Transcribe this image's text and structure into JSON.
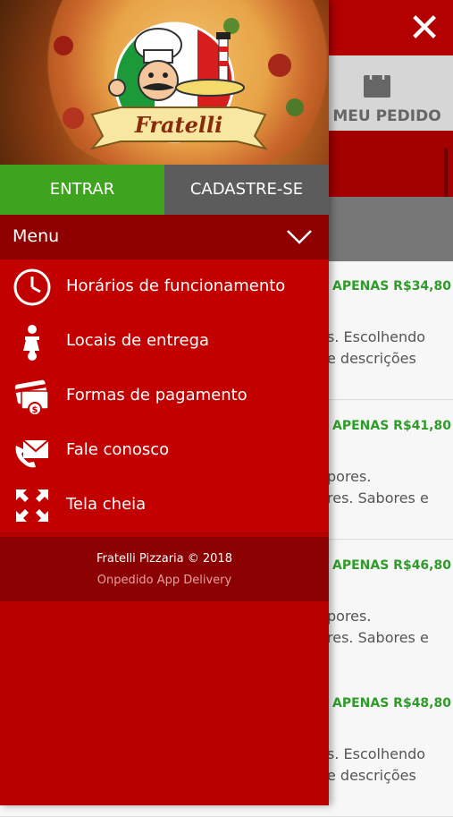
{
  "background": {
    "close_icon": "close-icon",
    "order": {
      "label": "MEU PEDIDO",
      "icon": "shopping-bag-icon"
    },
    "products": [
      {
        "price": "APENAS R$34,80",
        "desc1": "s. Escolhendo",
        "desc2": "e descrições"
      },
      {
        "price": "APENAS R$41,80",
        "desc1": "pores.",
        "desc2": "res. Sabores e"
      },
      {
        "price": "APENAS R$46,80",
        "desc1": "pores.",
        "desc2": "res. Sabores e"
      },
      {
        "price": "APENAS R$48,80",
        "desc1": "s. Escolhendo",
        "desc2": "e descrições"
      }
    ]
  },
  "drawer": {
    "logo_text": "Fratelli",
    "auth": {
      "login_label": "ENTRAR",
      "signup_label": "CADASTRE-SE"
    },
    "menu": {
      "title": "Menu",
      "items": [
        {
          "label": "Horários de funcionamento",
          "icon": "clock-icon"
        },
        {
          "label": "Locais de entrega",
          "icon": "scooter-icon"
        },
        {
          "label": "Formas de pagamento",
          "icon": "payment-icon"
        },
        {
          "label": "Fale conosco",
          "icon": "contact-icon"
        },
        {
          "label": "Tela cheia",
          "icon": "fullscreen-icon"
        }
      ]
    },
    "footer": {
      "copyright": "Fratelli Pizzaria © 2018",
      "powered_by": "Onpedido App Delivery"
    }
  },
  "colors": {
    "primary_red": "#b80000",
    "dark_red": "#8f0000",
    "green": "#3ea31e",
    "price_green": "#2f9b2a"
  }
}
